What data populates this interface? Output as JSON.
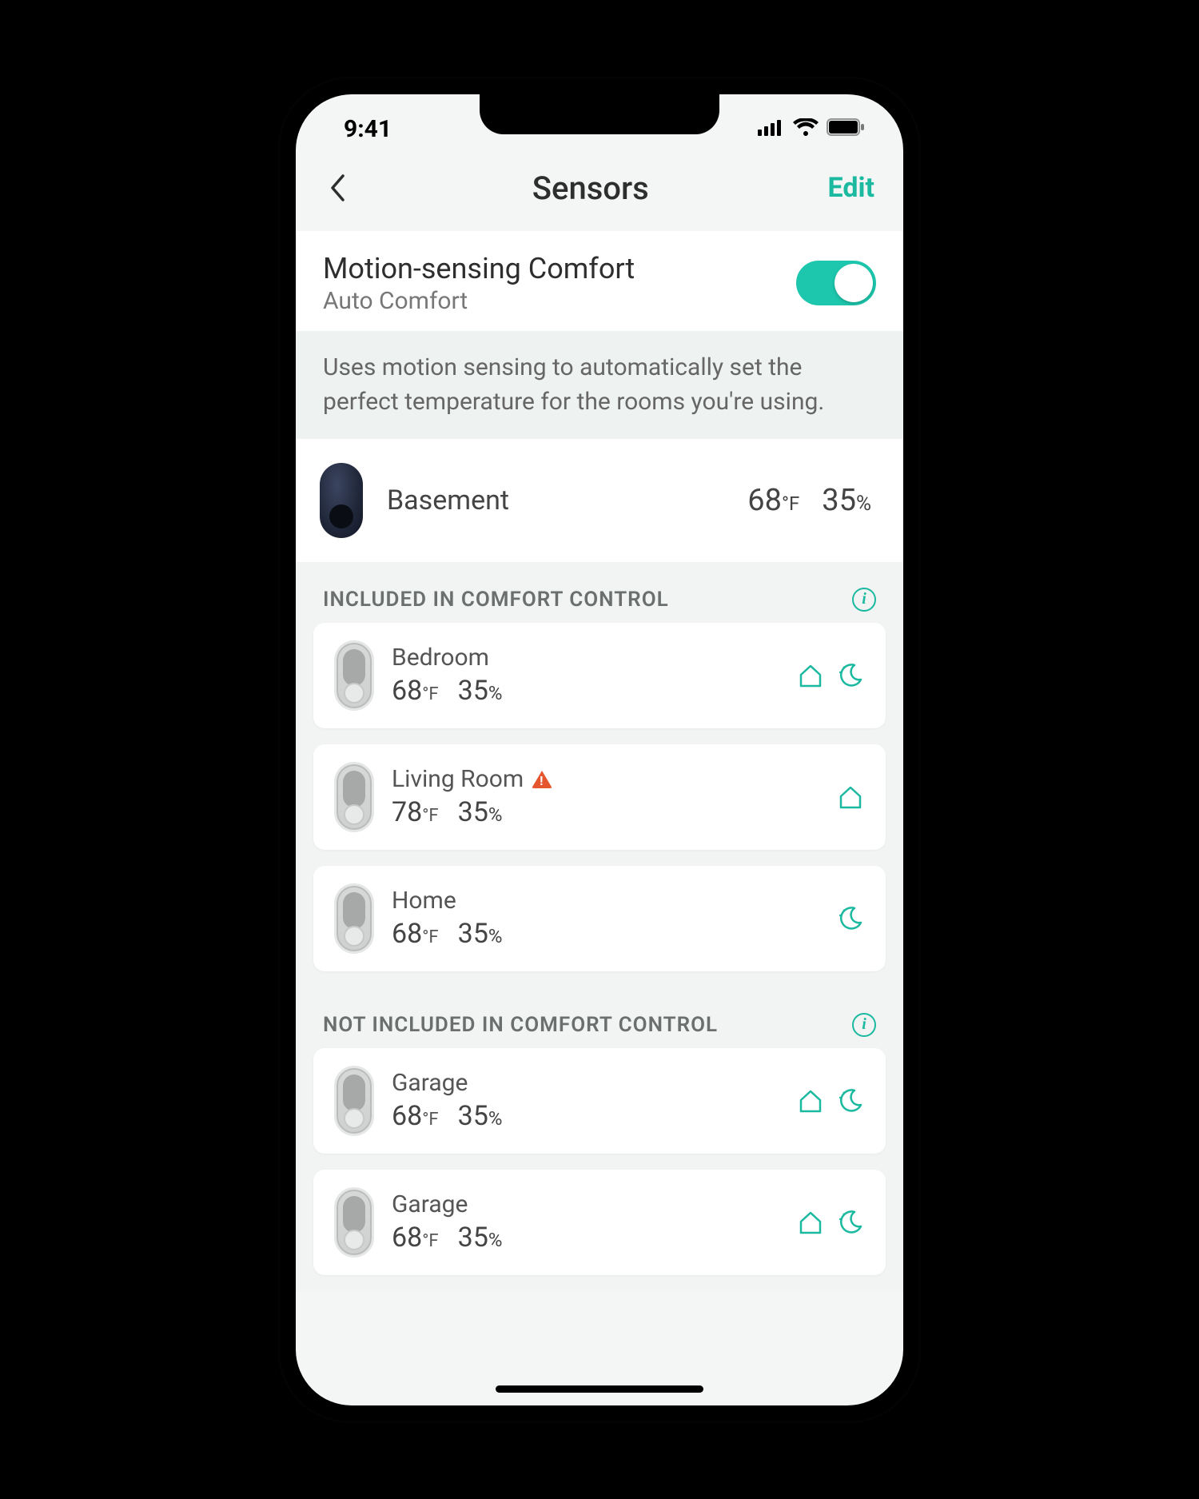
{
  "statusbar": {
    "time": "9:41"
  },
  "navbar": {
    "title": "Sensors",
    "edit": "Edit"
  },
  "motion": {
    "title": "Motion-sensing Comfort",
    "subtitle": "Auto Comfort",
    "enabled": true,
    "description": "Uses motion sensing to automatically set the perfect temperature for the rooms you're using."
  },
  "main_sensor": {
    "name": "Basement",
    "temp_value": "68",
    "temp_unit": "°F",
    "humidity_value": "35",
    "humidity_unit": "%"
  },
  "sections": {
    "included": {
      "title": "INCLUDED IN COMFORT CONTROL",
      "items": [
        {
          "name": "Bedroom",
          "temp": "68",
          "unit": "°F",
          "hum": "35",
          "hunit": "%",
          "warn": false,
          "home": true,
          "sleep": true
        },
        {
          "name": "Living Room",
          "temp": "78",
          "unit": "°F",
          "hum": "35",
          "hunit": "%",
          "warn": true,
          "home": true,
          "sleep": false
        },
        {
          "name": "Home",
          "temp": "68",
          "unit": "°F",
          "hum": "35",
          "hunit": "%",
          "warn": false,
          "home": false,
          "sleep": true
        }
      ]
    },
    "excluded": {
      "title": "NOT INCLUDED IN COMFORT CONTROL",
      "items": [
        {
          "name": "Garage",
          "temp": "68",
          "unit": "°F",
          "hum": "35",
          "hunit": "%",
          "warn": false,
          "home": true,
          "sleep": true
        },
        {
          "name": "Garage",
          "temp": "68",
          "unit": "°F",
          "hum": "35",
          "hunit": "%",
          "warn": false,
          "home": true,
          "sleep": true
        }
      ]
    }
  },
  "colors": {
    "accent": "#1bb9a0"
  }
}
